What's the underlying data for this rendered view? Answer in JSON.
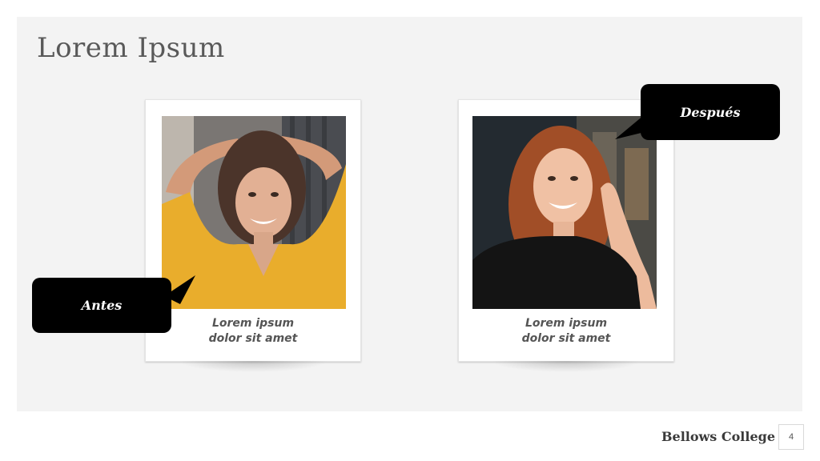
{
  "slide": {
    "title": "Lorem Ipsum",
    "cards": [
      {
        "caption_line1": "Lorem ipsum",
        "caption_line2": "dolor sit amet"
      },
      {
        "caption_line1": "Lorem ipsum",
        "caption_line2": "dolor sit amet"
      }
    ],
    "callouts": {
      "before": "Antes",
      "after": "Después"
    }
  },
  "footer": {
    "org": "Bellows College",
    "page_number": "4"
  },
  "colors": {
    "slide_bg": "#f3f3f3",
    "callout_bg": "#000000",
    "title": "#595959"
  }
}
